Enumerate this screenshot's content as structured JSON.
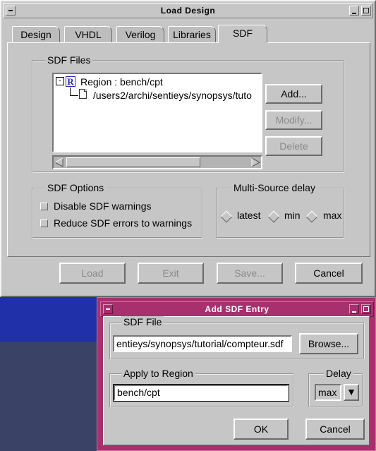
{
  "main_window": {
    "title": "Load Design",
    "tabs": [
      {
        "label": "Design"
      },
      {
        "label": "VHDL"
      },
      {
        "label": "Verilog"
      },
      {
        "label": "Libraries"
      },
      {
        "label": "SDF",
        "active": true
      }
    ],
    "sdf_files": {
      "group_label": "SDF Files",
      "tree": {
        "expander": "⊟",
        "region_badge": "R",
        "region_label": "Region : bench/cpt",
        "file_path": "/users2/archi/sentieys/synopsys/tuto"
      },
      "add_label": "Add...",
      "modify_label": "Modify...",
      "delete_label": "Delete"
    },
    "sdf_options": {
      "group_label": "SDF Options",
      "disable_warnings_label": "Disable SDF warnings",
      "reduce_errors_label": "Reduce SDF errors to warnings"
    },
    "multi_source_delay": {
      "group_label": "Multi-Source delay",
      "options": [
        "latest",
        "min",
        "max"
      ]
    },
    "footer": {
      "load_label": "Load",
      "exit_label": "Exit",
      "save_label": "Save...",
      "cancel_label": "Cancel"
    }
  },
  "add_sdf_dialog": {
    "title": "Add SDF Entry",
    "sdf_file": {
      "group_label": "SDF File",
      "value": "entieys/synopsys/tutorial/compteur.sdf",
      "browse_label": "Browse..."
    },
    "apply_to_region": {
      "group_label": "Apply to Region",
      "value": "bench/cpt"
    },
    "delay": {
      "group_label": "Delay",
      "selected": "max",
      "arrow": "▼"
    },
    "ok_label": "OK",
    "cancel_label": "Cancel"
  },
  "colors": {
    "window_bg": "#c6c6c6",
    "dialog_frame": "#a8306e",
    "desktop_blue": "#1f30a8",
    "desktop_dark": "#3a4266",
    "region_badge": "#2a2aa8"
  }
}
